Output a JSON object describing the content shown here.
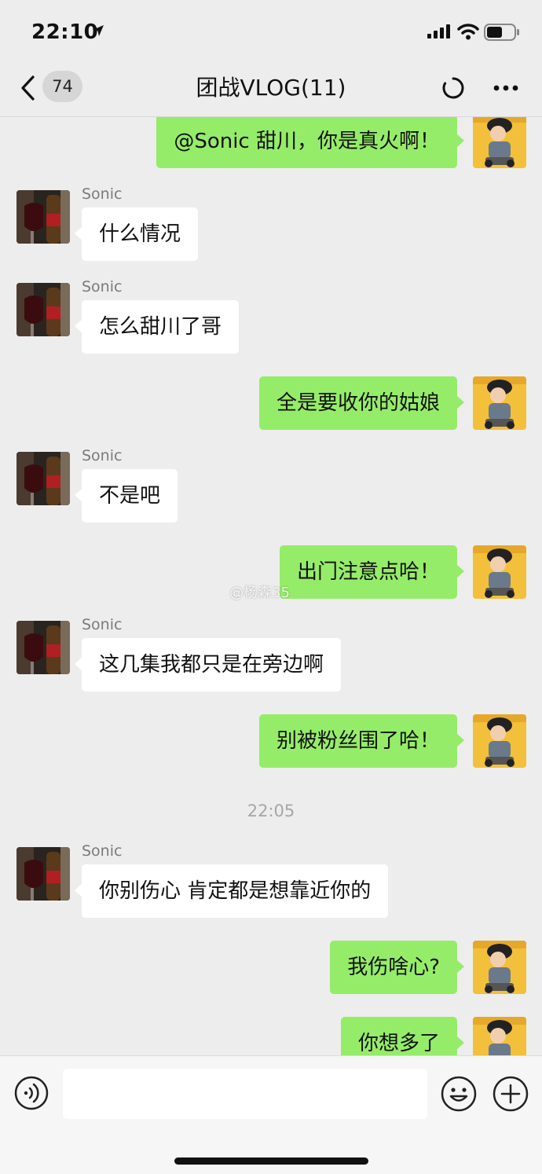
{
  "status_bar": {
    "time": "22:10"
  },
  "nav": {
    "unread_count": "74",
    "title": "团战VLOG(11)"
  },
  "watermark": "@杨森35",
  "messages": [
    {
      "direction": "out",
      "text": "@Sonic 甜川，你是真火啊！"
    },
    {
      "direction": "in",
      "sender": "Sonic",
      "text": "什么情况"
    },
    {
      "direction": "in",
      "sender": "Sonic",
      "text": "怎么甜川了哥"
    },
    {
      "direction": "out",
      "text": "全是要收你的姑娘"
    },
    {
      "direction": "in",
      "sender": "Sonic",
      "text": "不是吧"
    },
    {
      "direction": "out",
      "text": "出门注意点哈！"
    },
    {
      "direction": "in",
      "sender": "Sonic",
      "text": "这几集我都只是在旁边啊"
    },
    {
      "direction": "out",
      "text": "别被粉丝围了哈！"
    },
    {
      "type": "time",
      "text": "22:05"
    },
    {
      "direction": "in",
      "sender": "Sonic",
      "text": "你别伤心 肯定都是想靠近你的"
    },
    {
      "direction": "out",
      "text": "我伤啥心?"
    },
    {
      "direction": "out",
      "text": "你想多了"
    }
  ],
  "input": {
    "value": ""
  },
  "colors": {
    "background": "#ededed",
    "outgoing_bubble": "#95ec69",
    "incoming_bubble": "#ffffff",
    "sender_name": "#7a7a7a"
  },
  "icons": [
    "location-arrow-icon",
    "signal-icon",
    "wifi-icon",
    "battery-icon",
    "chevron-left-icon",
    "refresh-icon",
    "more-icon",
    "voice-icon",
    "emoji-icon",
    "plus-icon"
  ]
}
